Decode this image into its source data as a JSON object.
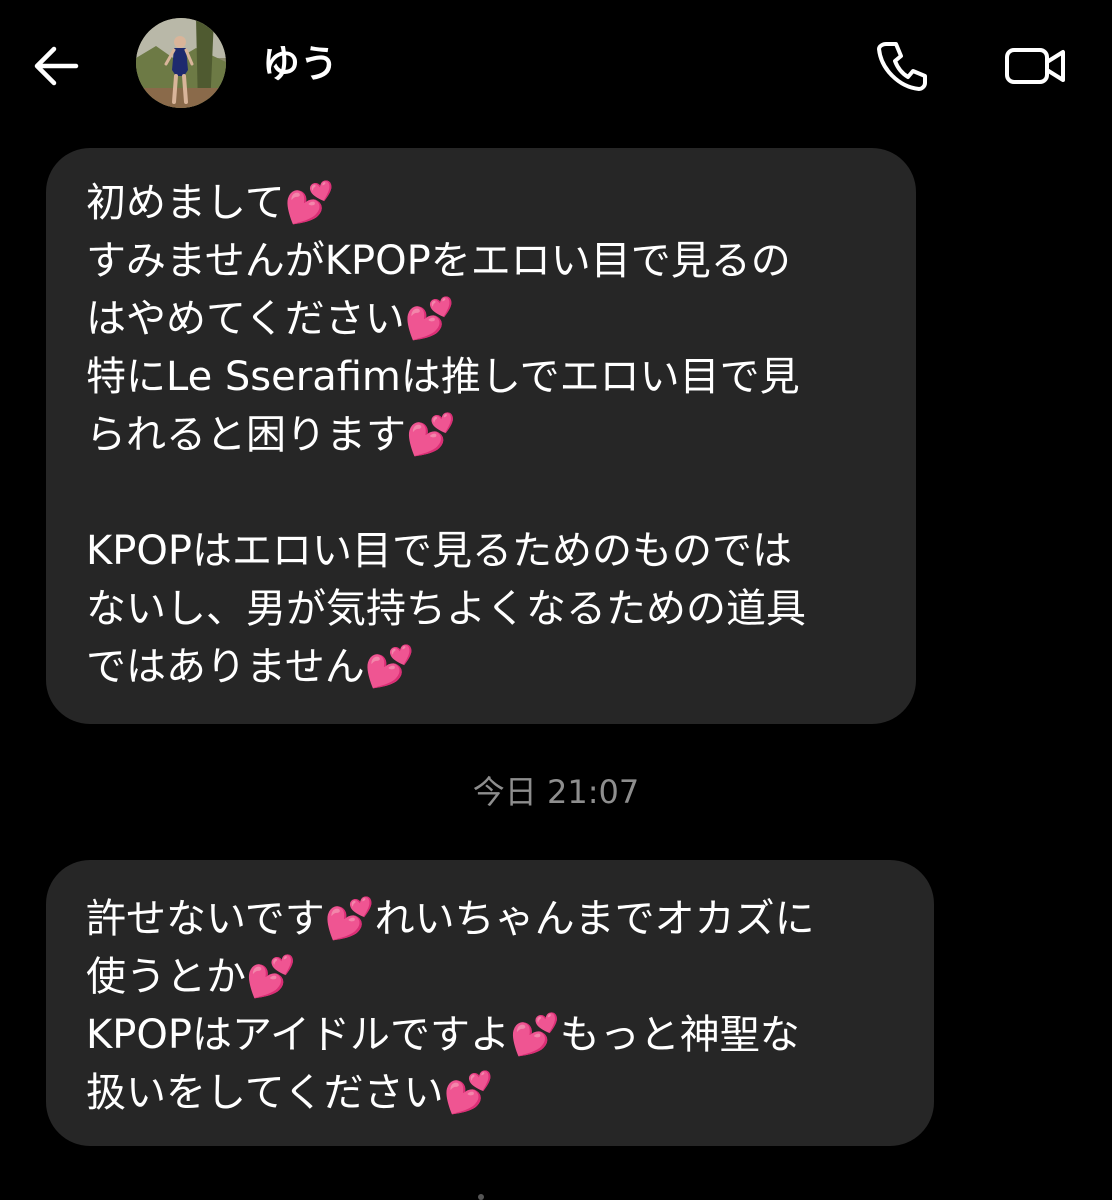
{
  "header": {
    "contact_name": "ゆう",
    "back_icon": "arrow-left-icon",
    "call_icon": "phone-icon",
    "video_icon": "video-camera-icon"
  },
  "messages": [
    {
      "lines": [
        "初めまして💕",
        "すみませんがKPOPをエロい目で見るの",
        "はやめてください💕",
        "特にLe Sserafimは推しでエロい目で見",
        "られると困ります💕",
        "",
        "KPOPはエロい目で見るためのものでは",
        "ないし、男が気持ちよくなるための道具",
        "ではありません💕"
      ]
    },
    {
      "lines": [
        "許せないです💕れいちゃんまでオカズに",
        "使うとか💕",
        "KPOPはアイドルですよ💕もっと神聖な",
        "扱いをしてください💕"
      ]
    }
  ],
  "timestamp": "今日 21:07",
  "colors": {
    "background": "#000000",
    "bubble": "#262626",
    "text": "#ffffff",
    "timestamp": "#8e8e8e"
  }
}
